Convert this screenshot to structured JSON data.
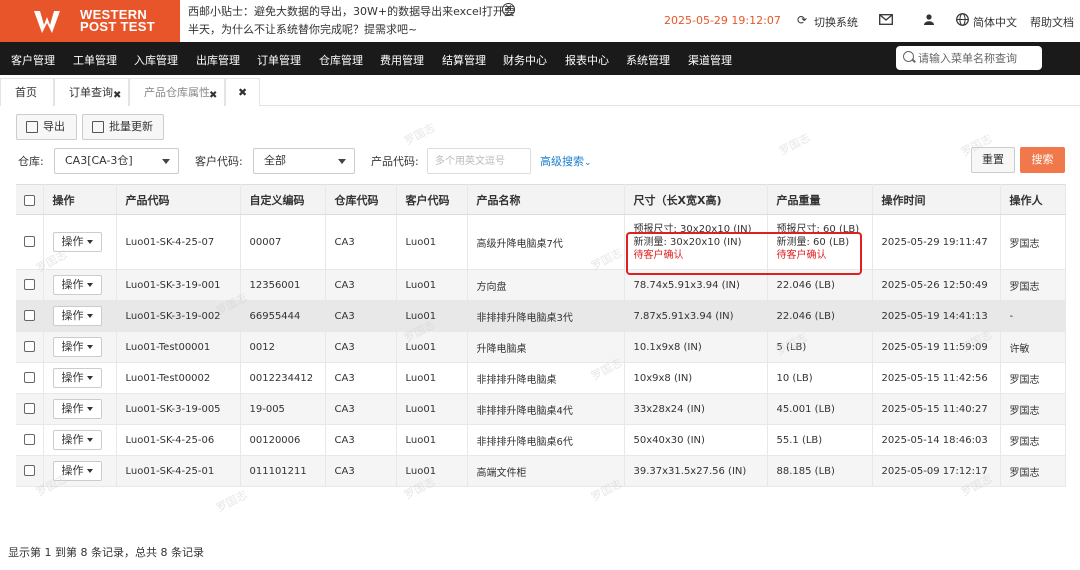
{
  "brand": {
    "line1": "WESTERN",
    "line2a": "POST",
    "line2b": "TEST"
  },
  "header": {
    "tip_line1": "西邮小贴士：避免大数据的导出，30W+的数据导出来excel打开要",
    "tip_line2": "半天，为什么不让系统替你完成呢？提需求吧~",
    "datetime": "2025-05-29 19:12:07",
    "switch_system": "切换系统",
    "language": "简体中文",
    "help": "帮助文档"
  },
  "nav": {
    "items": [
      "客户管理",
      "工单管理",
      "入库管理",
      "出库管理",
      "订单管理",
      "仓库管理",
      "费用管理",
      "结算管理",
      "财务中心",
      "报表中心",
      "系统管理",
      "渠道管理"
    ],
    "search_placeholder": "请输入菜单名称查询"
  },
  "tabs": [
    {
      "label": "首页"
    },
    {
      "label": "订单查询"
    },
    {
      "label": "产品仓库属性"
    }
  ],
  "toolbar": {
    "export": "导出",
    "batch_update": "批量更新"
  },
  "filters": {
    "warehouse_label": "仓库:",
    "warehouse_value": "CA3[CA-3仓]",
    "customer_label": "客户代码:",
    "customer_value": "全部",
    "product_label": "产品代码:",
    "product_placeholder": "多个用英文逗号",
    "advanced": "高级搜索",
    "reset": "重置",
    "search": "搜索"
  },
  "table": {
    "columns": [
      "操作",
      "产品代码",
      "自定义编码",
      "仓库代码",
      "客户代码",
      "产品名称",
      "尺寸（长X宽X高)",
      "产品重量",
      "操作时间",
      "操作人"
    ],
    "op_label": "操作",
    "rows": [
      {
        "code": "Luo01-SK-4-25-07",
        "custom": "00007",
        "wh": "CA3",
        "cust": "Luo01",
        "name": "高级升降电脑桌7代",
        "size_lines": [
          "预报尺寸: 30x20x10 (IN)",
          "新测量: 30x20x10 (IN)",
          "待客户确认"
        ],
        "weight_lines": [
          "预报尺寸: 60 (LB)",
          "新测量: 60 (LB)",
          "待客户确认"
        ],
        "time": "2025-05-29 19:11:47",
        "operator": "罗国志"
      },
      {
        "code": "Luo01-SK-3-19-001",
        "custom": "12356001",
        "wh": "CA3",
        "cust": "Luo01",
        "name": "方向盘",
        "size": "78.74x5.91x3.94 (IN)",
        "weight": "22.046 (LB)",
        "time": "2025-05-26 12:50:49",
        "operator": "罗国志"
      },
      {
        "code": "Luo01-SK-3-19-002",
        "custom": "66955444",
        "wh": "CA3",
        "cust": "Luo01",
        "name": "非排排升降电脑桌3代",
        "size": "7.87x5.91x3.94 (IN)",
        "weight": "22.046 (LB)",
        "time": "2025-05-19 14:41:13",
        "operator": "-"
      },
      {
        "code": "Luo01-Test00001",
        "custom": "0012",
        "wh": "CA3",
        "cust": "Luo01",
        "name": "升降电脑桌",
        "size": "10.1x9x8 (IN)",
        "weight": "5 (LB)",
        "time": "2025-05-19 11:59:09",
        "operator": "许敏"
      },
      {
        "code": "Luo01-Test00002",
        "custom": "0012234412",
        "wh": "CA3",
        "cust": "Luo01",
        "name": "非排排升降电脑桌",
        "size": "10x9x8 (IN)",
        "weight": "10 (LB)",
        "time": "2025-05-15 11:42:56",
        "operator": "罗国志"
      },
      {
        "code": "Luo01-SK-3-19-005",
        "custom": "19-005",
        "wh": "CA3",
        "cust": "Luo01",
        "name": "非排排升降电脑桌4代",
        "size": "33x28x24 (IN)",
        "weight": "45.001 (LB)",
        "time": "2025-05-15 11:40:27",
        "operator": "罗国志"
      },
      {
        "code": "Luo01-SK-4-25-06",
        "custom": "00120006",
        "wh": "CA3",
        "cust": "Luo01",
        "name": "非排排升降电脑桌6代",
        "size": "50x40x30 (IN)",
        "weight": "55.1 (LB)",
        "time": "2025-05-14 18:46:03",
        "operator": "罗国志"
      },
      {
        "code": "Luo01-SK-4-25-01",
        "custom": "011101211",
        "wh": "CA3",
        "cust": "Luo01",
        "name": "高端文件柜",
        "size": "39.37x31.5x27.56 (IN)",
        "weight": "88.185 (LB)",
        "time": "2025-05-09 17:12:17",
        "operator": "罗国志"
      }
    ]
  },
  "footer": "显示第 1 到第 8 条记录，总共 8 条记录",
  "watermark": "罗国志",
  "colors": {
    "brand": "#e8552a",
    "search_button": "#f0784a",
    "link": "#1a7fd1",
    "alert": "#e02020",
    "nav_bg": "#1a1a1a"
  }
}
